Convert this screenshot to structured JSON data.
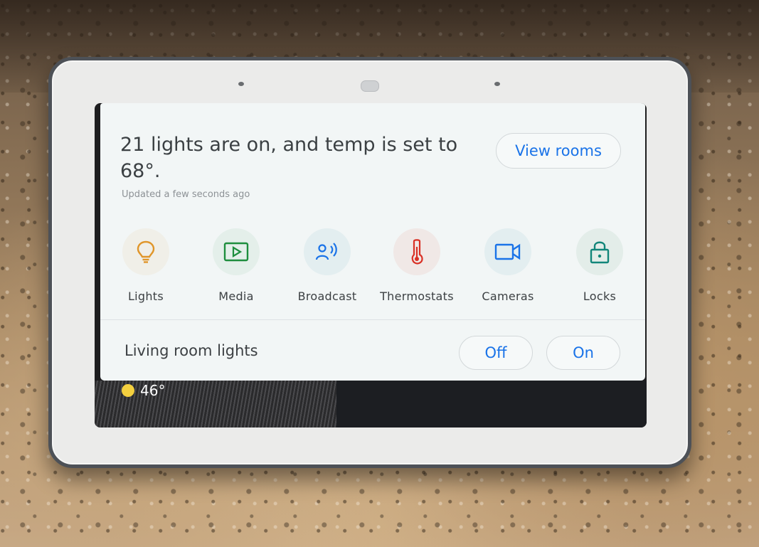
{
  "status": {
    "headline": "21 lights are on, and temp is set to 68°.",
    "updated": "Updated a few seconds ago"
  },
  "actions": {
    "view_rooms": "View rooms"
  },
  "tiles": [
    {
      "label": "Lights",
      "icon": "bulb-icon",
      "color": "#e0962a",
      "bg": "#f0efe8"
    },
    {
      "label": "Media",
      "icon": "play-icon",
      "color": "#1e8e3e",
      "bg": "#e4efea"
    },
    {
      "label": "Broadcast",
      "icon": "broadcast-icon",
      "color": "#1a73e8",
      "bg": "#e3eef0"
    },
    {
      "label": "Thermostats",
      "icon": "thermometer-icon",
      "color": "#d93025",
      "bg": "#f0e8e6"
    },
    {
      "label": "Cameras",
      "icon": "camera-icon",
      "color": "#1a73e8",
      "bg": "#e3eef0"
    },
    {
      "label": "Locks",
      "icon": "lock-icon",
      "color": "#12867a",
      "bg": "#e3ede9"
    }
  ],
  "quick_control": {
    "label": "Living room lights",
    "off_label": "Off",
    "on_label": "On"
  },
  "ambient": {
    "temperature": "46°",
    "weather_icon": "sun-icon"
  }
}
